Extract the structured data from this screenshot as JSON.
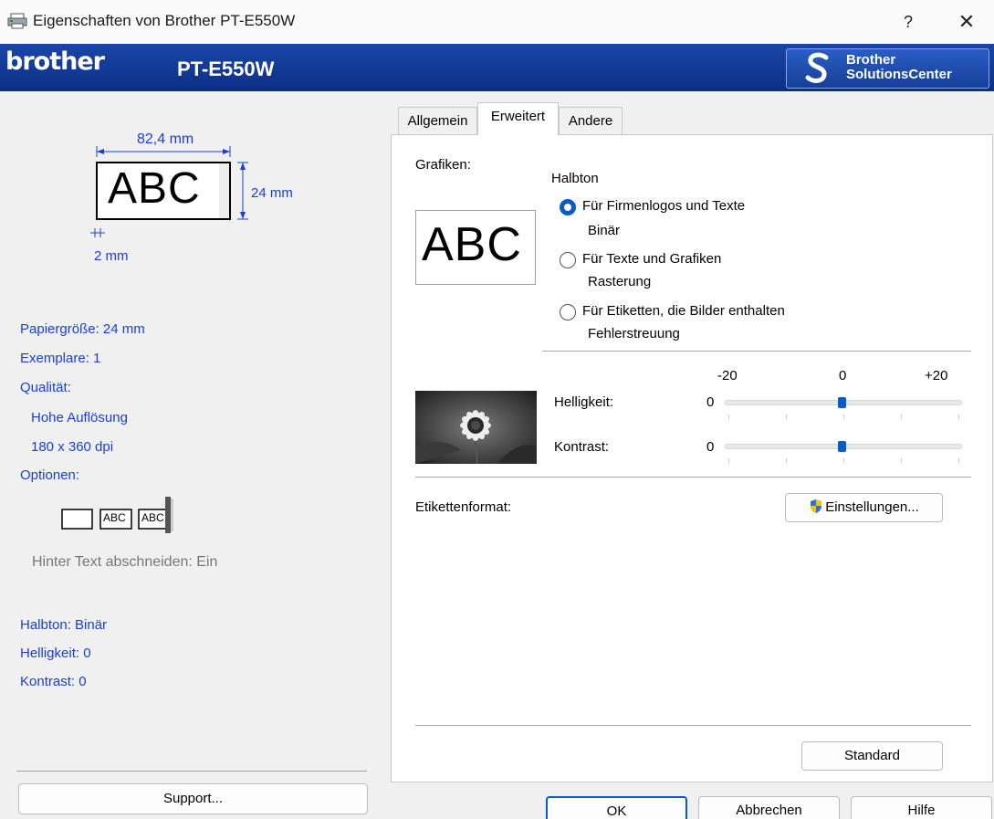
{
  "window": {
    "title": "Eigenschaften von Brother PT-E550W",
    "help_label": "?",
    "close_label": "✕"
  },
  "banner": {
    "brand": "brother",
    "model": "PT-E550W",
    "solutions_line1": "Brother",
    "solutions_line2": "SolutionsCenter",
    "icon": "brother-solutions-s-icon"
  },
  "preview": {
    "width_dim": "82,4 mm",
    "height_dim": "24 mm",
    "margin_dim": "2 mm",
    "sample_text": "ABC"
  },
  "summary": {
    "paper_size": "Papiergröße: 24 mm",
    "copies": "Exemplare: 1",
    "quality_label": "Qualität:",
    "quality_value": "Hohe Auflösung",
    "resolution": "180 x 360 dpi",
    "options_label": "Optionen:",
    "option_samples": [
      "ABC",
      "ABC"
    ],
    "cut_text": "Hinter Text abschneiden: Ein",
    "halftone": "Halbton: Binär",
    "brightness": "Helligkeit:  0",
    "contrast": "Kontrast:  0"
  },
  "support_button": "Support...",
  "tabs": [
    {
      "label": "Allgemein",
      "active": false
    },
    {
      "label": "Erweitert",
      "active": true
    },
    {
      "label": "Andere",
      "active": false
    }
  ],
  "advanced": {
    "graphics_label": "Grafiken:",
    "halftone_label": "Halbton",
    "sample_text": "ABC",
    "radios": [
      {
        "label": "Für Firmenlogos und Texte",
        "sub": "Binär",
        "checked": true
      },
      {
        "label": "Für Texte und Grafiken",
        "sub": "Rasterung",
        "checked": false
      },
      {
        "label": "Für Etiketten, die Bilder enthalten",
        "sub": "Fehlerstreuung",
        "checked": false
      }
    ],
    "scale": {
      "min": "-20",
      "mid": "0",
      "max": "+20"
    },
    "brightness_label": "Helligkeit:",
    "brightness_value": "0",
    "brightness_level": 0,
    "contrast_label": "Kontrast:",
    "contrast_value": "0",
    "contrast_level": 0,
    "label_format_label": "Etikettenformat:",
    "settings_button": "Einstellungen...",
    "settings_icon": "uac-shield-icon",
    "standard_button": "Standard"
  },
  "footer": {
    "ok": "OK",
    "cancel": "Abbrechen",
    "help": "Hilfe"
  },
  "colors": {
    "banner": "#1a46a8",
    "accent": "#0a5bc8",
    "summary_text": "#1a3fd6"
  }
}
